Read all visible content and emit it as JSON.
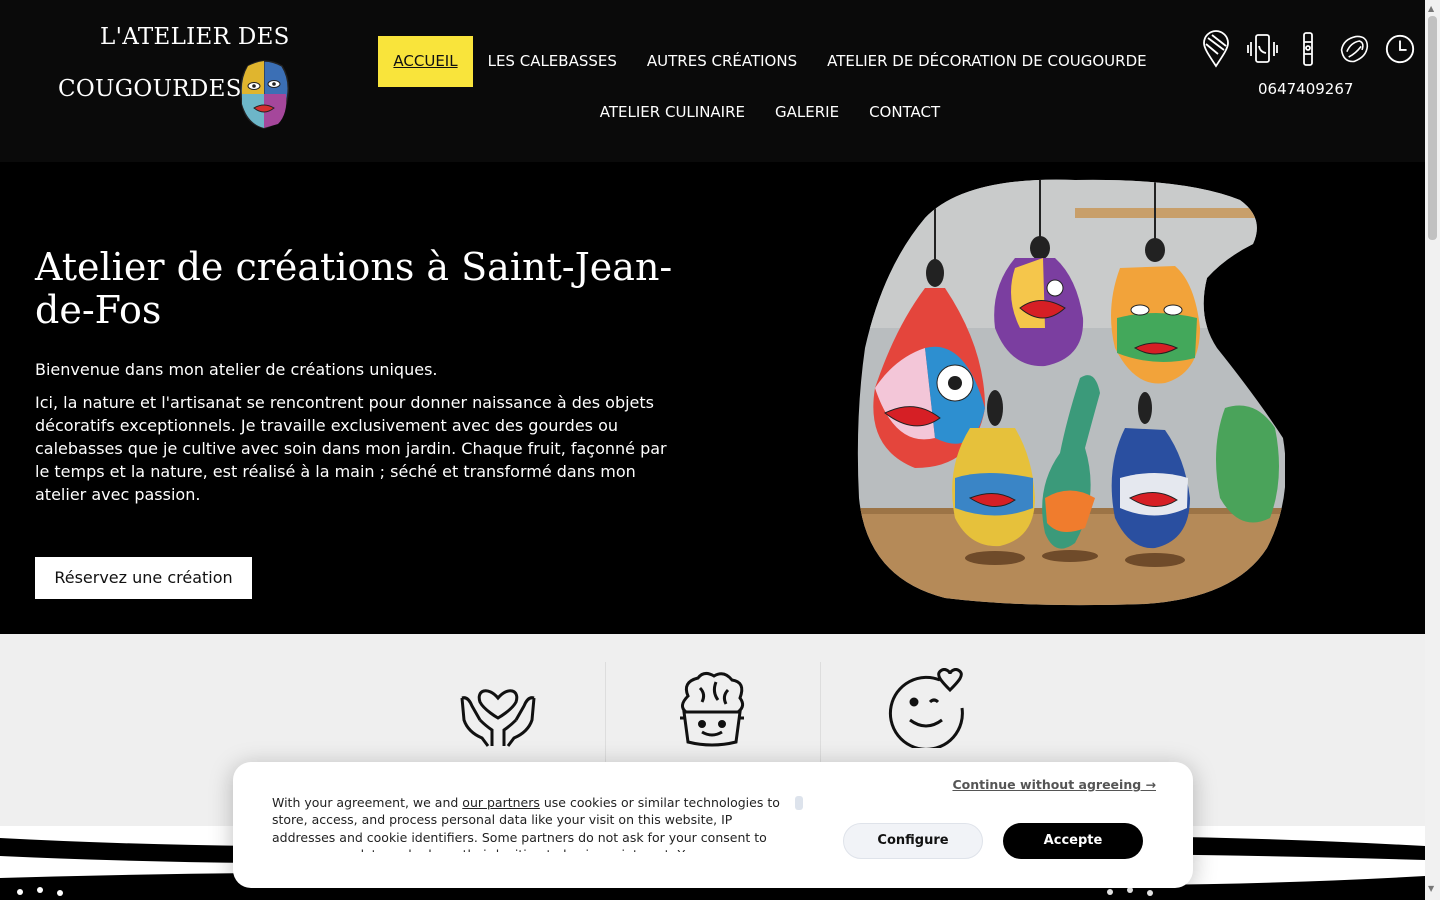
{
  "logo": {
    "line1": "L'ATELIER DES",
    "line2": "COUGOURDES"
  },
  "nav": {
    "row1": [
      {
        "label": "ACCUEIL",
        "active": true
      },
      {
        "label": "LES CALEBASSES"
      },
      {
        "label": "AUTRES CRÉATIONS"
      },
      {
        "label": "ATELIER DE DÉCORATION DE COUGOURDE"
      }
    ],
    "row2": [
      {
        "label": "ATELIER CULINAIRE"
      },
      {
        "label": "GALERIE"
      },
      {
        "label": "CONTACT"
      }
    ]
  },
  "header_icons": [
    "map-pin-icon",
    "phone-icon",
    "instagram-icon",
    "tripadvisor-icon",
    "clock-icon"
  ],
  "phone": "0647409267",
  "hero": {
    "title": "Atelier de créations à Saint-Jean-de-Fos",
    "p1": "Bienvenue dans mon atelier de créations uniques.",
    "p2": "Ici, la nature et l'artisanat se rencontrent pour donner naissance à des objets décoratifs exceptionnels. Je travaille exclusivement avec des gourdes ou calebasses que je cultive avec soin dans mon jardin. Chaque fruit, façonné par le temps et la nature, est réalisé à la main ; séché et transformé dans mon atelier avec passion.",
    "button": "Réservez une création"
  },
  "features": [
    "hands-heart-icon",
    "brain-pot-icon",
    "smiley-heart-icon"
  ],
  "cookie": {
    "text_before": "With your agreement, we and ",
    "link": "our partners",
    "text_after": " use cookies or similar technologies to store, access, and process personal data like your visit on this website, IP addresses and cookie identifiers. Some partners do not ask for your consent to process your data and rely on their legitimate business interest. You can",
    "continue": "Continue without agreeing →",
    "configure": "Configure",
    "accept": "Accepte"
  },
  "colors": {
    "accent": "#f9e43b",
    "background": "#000000",
    "features_bg": "#efefef"
  }
}
